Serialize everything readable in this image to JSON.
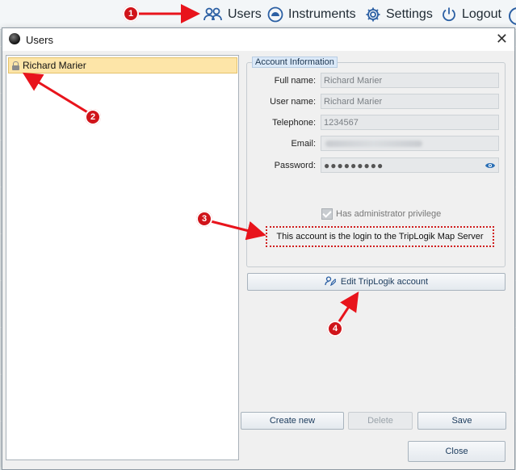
{
  "topbar": {
    "nav": [
      {
        "label": "Users",
        "icon": "users-icon"
      },
      {
        "label": "Instruments",
        "icon": "gauge-icon"
      },
      {
        "label": "Settings",
        "icon": "gear-icon"
      },
      {
        "label": "Logout",
        "icon": "power-icon"
      }
    ]
  },
  "dialog": {
    "title": "Users",
    "close_glyph": "✕",
    "users": [
      {
        "name": "Richard Marier",
        "icon": "lock-icon",
        "selected": true
      }
    ],
    "account": {
      "legend": "Account Information",
      "fields": [
        {
          "label": "Full name:",
          "value": "Richard Marier"
        },
        {
          "label": "User name:",
          "value": "Richard Marier"
        },
        {
          "label": "Telephone:",
          "value": "1234567"
        },
        {
          "label": "Email:",
          "value": ""
        },
        {
          "label": "Password:",
          "value": "●●●●●●●●●"
        }
      ],
      "admin_label": "Has administrator privilege",
      "admin_checked": true,
      "login_note": "This account is the login to the TripLogik Map Server"
    },
    "buttons": {
      "edit_account": "Edit TripLogik account",
      "create_new": "Create new",
      "delete": "Delete",
      "save": "Save",
      "close": "Close"
    }
  },
  "annotations": [
    "1",
    "2",
    "3",
    "4"
  ],
  "colors": {
    "annotation": "#d0141a",
    "selection": "#fde5a8",
    "accent": "#2b5fa3"
  }
}
